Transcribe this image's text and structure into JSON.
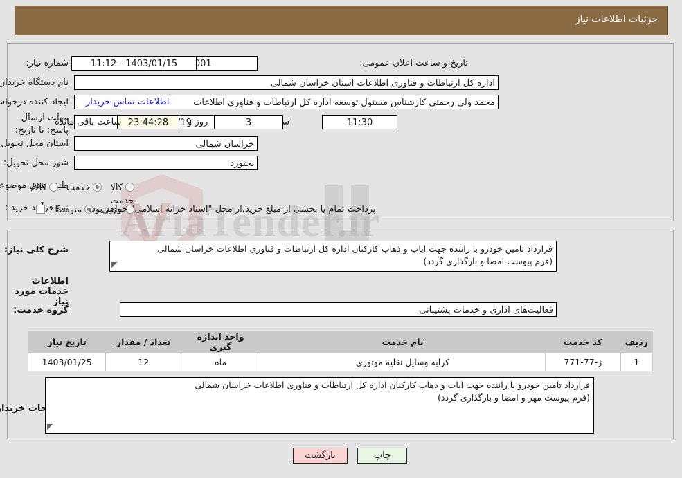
{
  "header": {
    "title": "جزئیات اطلاعات نیاز",
    "bg_color": "#8b6b43"
  },
  "watermark": {
    "text": "AriaTender.ir"
  },
  "top_section": {
    "need_number": {
      "label": "شماره نیاز:",
      "value": "1103000264000001"
    },
    "announce_datetime": {
      "label": "تاریخ و ساعت اعلان عمومی:",
      "value": "1403/01/15 - 11:12"
    },
    "buyer_org": {
      "label": "نام دستگاه خریدار:",
      "value": "اداره کل ارتباطات و فناوری اطلاعات استان خراسان شمالی"
    },
    "creator": {
      "label": "ایجاد کننده درخواست:",
      "value": "محمد ولی  رحمتی کارشناس مسئول توسعه اداره کل ارتباطات و فناوری اطلاعات",
      "link": "اطلاعات تماس خریدار"
    },
    "deadline": {
      "label": "مهلت ارسال پاسخ: تا تاریخ:",
      "date": "1403/01/19",
      "hour_label": "ساعت",
      "hour": "11:30",
      "days": "3",
      "days_label": "روز و",
      "countdown": "23:44:28",
      "remaining_label": "ساعت باقی مانده"
    },
    "province": {
      "label": "استان محل تحویل:",
      "value": "خراسان شمالی"
    },
    "city": {
      "label": "شهر محل تحویل:",
      "value": "بجنورد"
    },
    "category": {
      "label": "طبقه بندی موضوعی:",
      "options": [
        "کالا",
        "خدمت",
        "کالا/خدمت"
      ],
      "selected": "خدمت"
    },
    "process": {
      "label": "نوع فرآیند خرید :",
      "options": [
        "جزیی",
        "متوسط"
      ],
      "selected": "متوسط",
      "checkbox_checked": false,
      "note": "پرداخت تمام یا بخشی از مبلغ خرید،از محل \"اسناد خزانه اسلامی\" خواهد بود."
    }
  },
  "bottom_section": {
    "general_desc": {
      "label": "شرح کلی نیاز:",
      "line1": "قرارداد تامین خودرو با راننده جهت ایاب و ذهاب کارکنان اداره کل ارتباطات و فناوری اطلاعات خراسان شمالی",
      "line2": "(فرم پیوست امضا و بارگذاری گردد)"
    },
    "services_heading": "اطلاعات خدمات مورد نیاز",
    "service_group": {
      "label": "گروه خدمت:",
      "value": "فعالیت‌های اداری و خدمات پشتیبانی"
    },
    "table": {
      "columns": [
        "ردیف",
        "کد خدمت",
        "نام خدمت",
        "واحد اندازه گیری",
        "تعداد / مقدار",
        "تاریخ نیاز"
      ],
      "rows": [
        {
          "radif": "1",
          "code": "ژ-77-771",
          "name": "کرایه وسایل نقلیه موتوری",
          "unit": "ماه",
          "qty": "12",
          "date": "1403/01/25"
        }
      ]
    },
    "buyer_notes": {
      "label": "توضیحات خریدار:",
      "line1": "قرارداد تامین خودرو با راننده جهت ایاب و ذهاب کارکنان اداره کل ارتباطات و فناوری اطلاعات خراسان شمالی",
      "line2": "(فرم پیوست مهر و امضا و بارگذاری گردد)"
    }
  },
  "footer": {
    "print_label": "چاپ",
    "back_label": "بازگشت"
  }
}
